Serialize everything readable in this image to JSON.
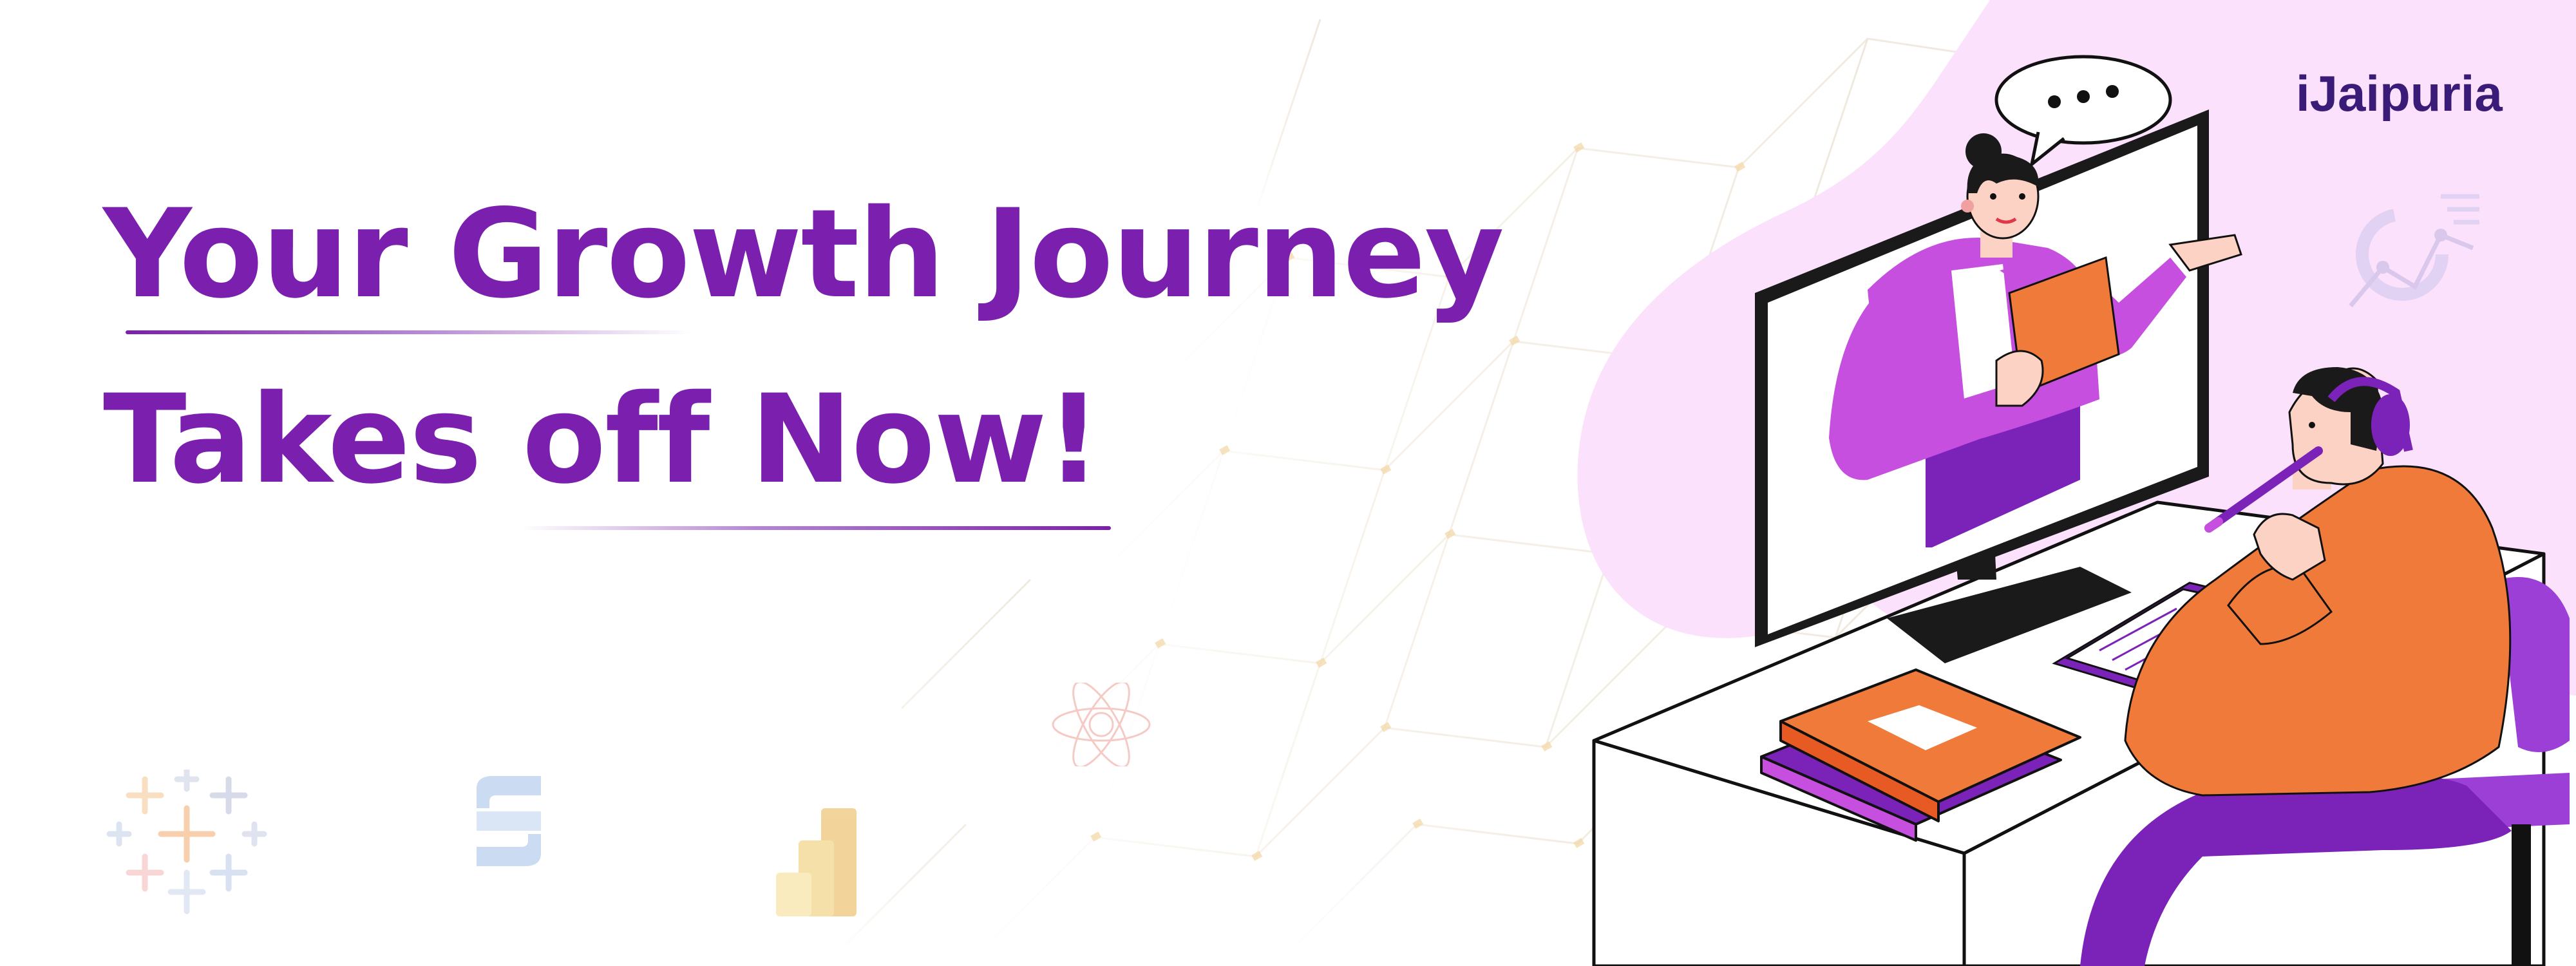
{
  "brand": {
    "logo_text": "iJaipuria",
    "accent_color": "#7a1fae",
    "blob_color": "#fbe3fb"
  },
  "headline": {
    "line1": "Your Growth Journey",
    "line2": "Takes off Now!"
  },
  "decorative_icons": [
    "tableau-icon",
    "data-tool-s-icon",
    "power-bi-icon",
    "atom-icon",
    "analytics-gauge-icon"
  ],
  "illustration": {
    "speech_bubble_text": "•••",
    "shirt_color": "#f07a3a",
    "purple": "#7b22b8",
    "lilac": "#c64fe0"
  }
}
